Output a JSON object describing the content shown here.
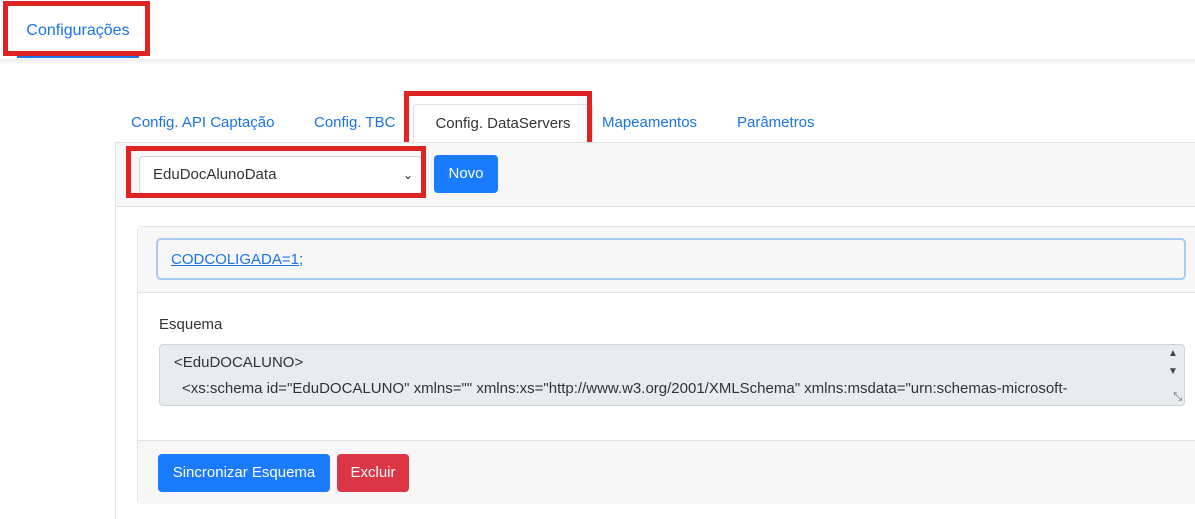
{
  "header": {
    "tab_label": "Configurações"
  },
  "tabs": [
    {
      "label": "Config. API Captação"
    },
    {
      "label": "Config. TBC"
    },
    {
      "label": "Config. DataServers"
    },
    {
      "label": "Mapeamentos"
    },
    {
      "label": "Parâmetros"
    }
  ],
  "toolbar": {
    "dataserver_selected": "EduDocAlunoData",
    "new_button": "Novo"
  },
  "filter": {
    "value": "CODCOLIGADA=1;"
  },
  "schema": {
    "label": "Esquema",
    "line1": "<EduDOCALUNO>",
    "line2": "<xs:schema id=\"EduDOCALUNO\" xmlns=\"\" xmlns:xs=\"http://www.w3.org/2001/XMLSchema\" xmlns:msdata=\"urn:schemas-microsoft-"
  },
  "actions": {
    "sync_button": "Sincronizar Esquema",
    "delete_button": "Excluir"
  },
  "colors": {
    "primary": "#1a7bff",
    "danger": "#dc3545",
    "highlight": "#e02424",
    "link": "#1a73e8"
  }
}
